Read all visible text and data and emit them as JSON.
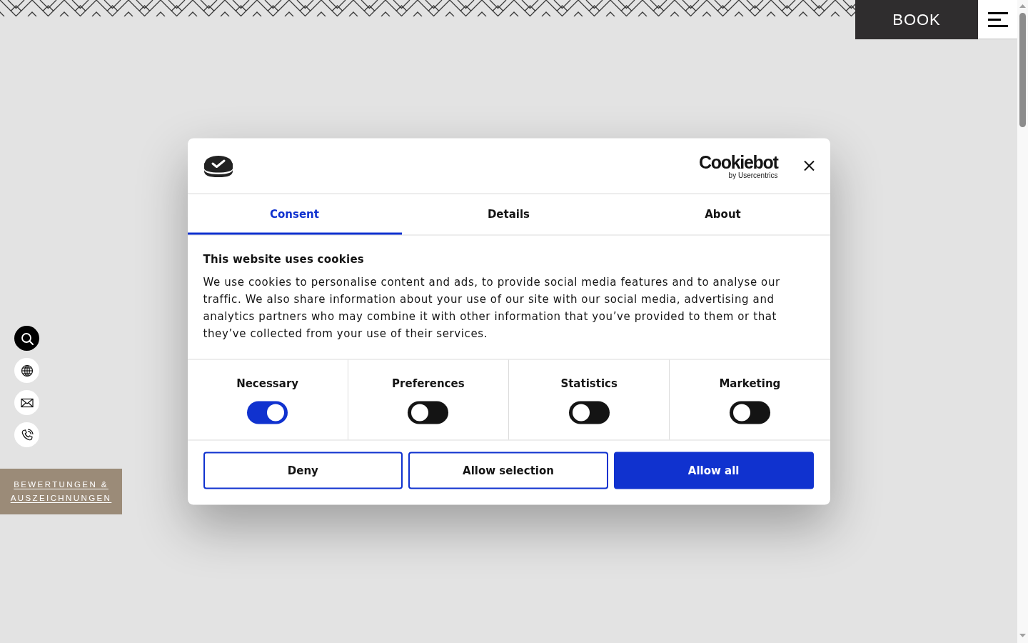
{
  "header": {
    "book_label": "BOOK"
  },
  "reviews_link": "BEWERTUNGEN & AUSZEICHNUNGEN",
  "consent_dialog": {
    "brand": {
      "name": "Cookiebot",
      "byline": "by Usercentrics"
    },
    "tabs": [
      {
        "label": "Consent",
        "selected": true
      },
      {
        "label": "Details",
        "selected": false
      },
      {
        "label": "About",
        "selected": false
      }
    ],
    "title": "This website uses cookies",
    "text": "We use cookies to personalise content and ads, to provide social media features and to analyse our traffic. We also share information about your use of our site with our social media, advertising and analytics partners who may combine it with other information that you’ve provided to them or that they’ve collected from your use of their services.",
    "categories": [
      {
        "label": "Necessary",
        "on": true
      },
      {
        "label": "Preferences",
        "on": false
      },
      {
        "label": "Statistics",
        "on": false
      },
      {
        "label": "Marketing",
        "on": false
      }
    ],
    "buttons": [
      {
        "label": "Deny",
        "kind": "outline"
      },
      {
        "label": "Allow selection",
        "kind": "outline"
      },
      {
        "label": "Allow all",
        "kind": "filled"
      }
    ]
  }
}
